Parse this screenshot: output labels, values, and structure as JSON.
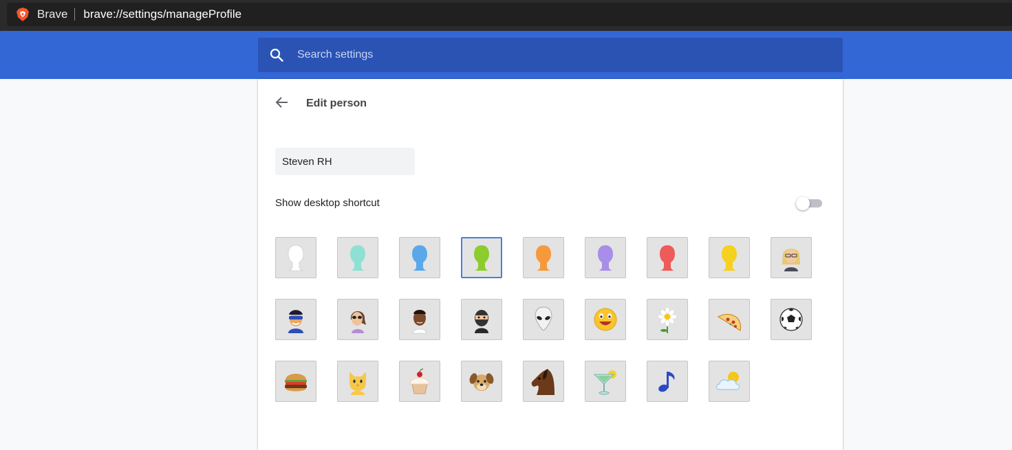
{
  "browser": {
    "name": "Brave",
    "url": "brave://settings/manageProfile"
  },
  "header": {
    "search_placeholder": "Search settings"
  },
  "page": {
    "title": "Edit person",
    "name_value": "Steven RH",
    "shortcut_label": "Show desktop shortcut",
    "shortcut_enabled": false
  },
  "avatars": [
    {
      "icon": "white-silhouette-icon",
      "selected": false
    },
    {
      "icon": "teal-silhouette-icon",
      "selected": false
    },
    {
      "icon": "blue-silhouette-icon",
      "selected": false
    },
    {
      "icon": "green-silhouette-icon",
      "selected": true
    },
    {
      "icon": "orange-silhouette-icon",
      "selected": false
    },
    {
      "icon": "purple-silhouette-icon",
      "selected": false
    },
    {
      "icon": "red-silhouette-icon",
      "selected": false
    },
    {
      "icon": "yellow-silhouette-icon",
      "selected": false
    },
    {
      "icon": "businesswoman-icon",
      "selected": false
    },
    {
      "icon": "superhero-icon",
      "selected": false
    },
    {
      "icon": "woman-with-sunglasses-icon",
      "selected": false
    },
    {
      "icon": "man-icon",
      "selected": false
    },
    {
      "icon": "ninja-icon",
      "selected": false
    },
    {
      "icon": "alien-icon",
      "selected": false
    },
    {
      "icon": "smiley-icon",
      "selected": false
    },
    {
      "icon": "flower-icon",
      "selected": false
    },
    {
      "icon": "pizza-icon",
      "selected": false
    },
    {
      "icon": "soccer-ball-icon",
      "selected": false
    },
    {
      "icon": "burger-icon",
      "selected": false
    },
    {
      "icon": "cat-icon",
      "selected": false
    },
    {
      "icon": "cupcake-icon",
      "selected": false
    },
    {
      "icon": "dog-icon",
      "selected": false
    },
    {
      "icon": "horse-icon",
      "selected": false
    },
    {
      "icon": "cocktail-icon",
      "selected": false
    },
    {
      "icon": "music-note-icon",
      "selected": false
    },
    {
      "icon": "sun-and-cloud-icon",
      "selected": false
    }
  ],
  "colors": {
    "header_blue": "#3367d6",
    "search_blue": "#2a53b4",
    "selected_border": "#4a7fd9"
  }
}
